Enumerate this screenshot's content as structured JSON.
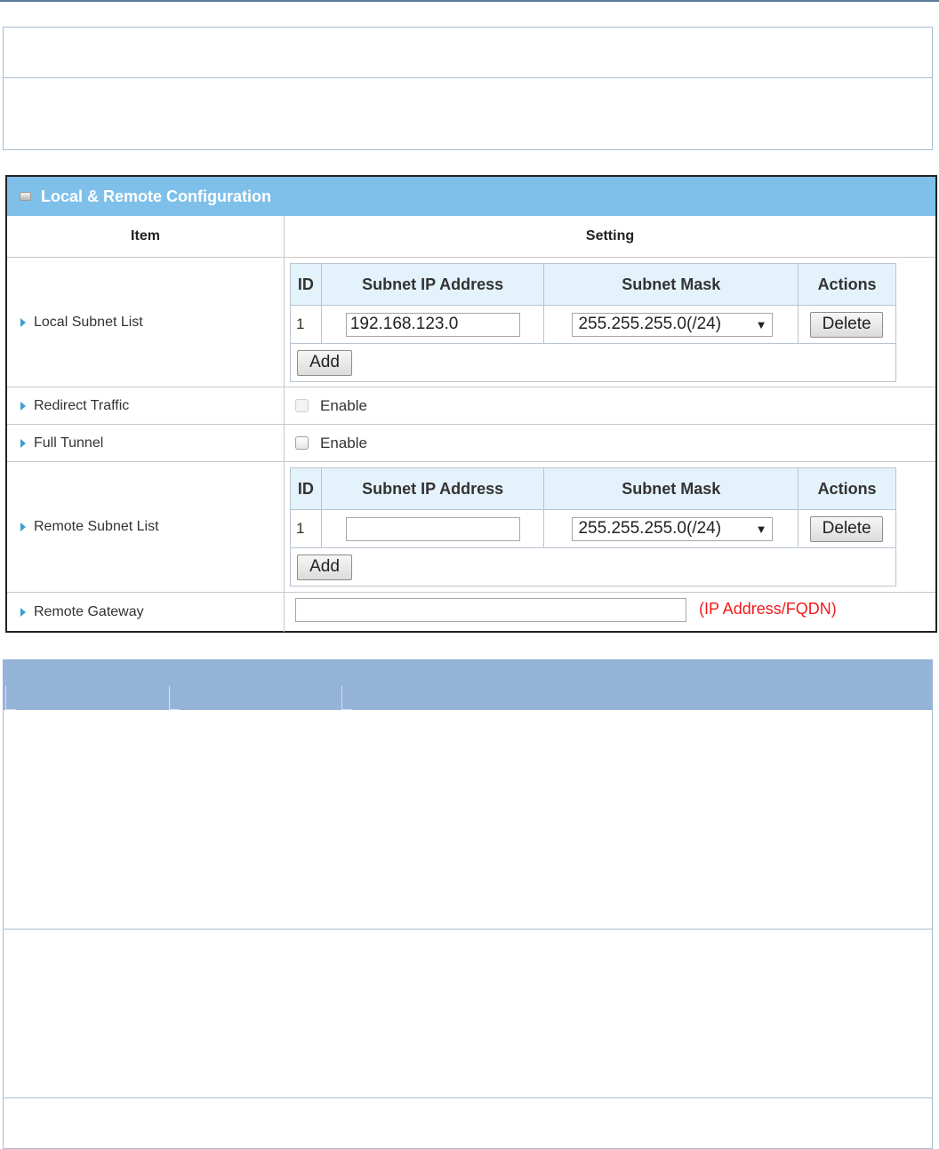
{
  "panel": {
    "title": "Local & Remote Configuration",
    "header_item": "Item",
    "header_setting": "Setting"
  },
  "subnet_table_headers": {
    "id": "ID",
    "ip": "Subnet IP Address",
    "mask": "Subnet Mask",
    "actions": "Actions"
  },
  "local_subnet": {
    "label": "Local Subnet List",
    "row": {
      "id": "1",
      "ip": "192.168.123.0",
      "mask": "255.255.255.0(/24)"
    },
    "delete_label": "Delete",
    "add_label": "Add"
  },
  "redirect_traffic": {
    "label": "Redirect Traffic",
    "checkbox_label": "Enable"
  },
  "full_tunnel": {
    "label": "Full Tunnel",
    "checkbox_label": "Enable"
  },
  "remote_subnet": {
    "label": "Remote Subnet List",
    "row": {
      "id": "1",
      "ip": "",
      "mask": "255.255.255.0(/24)"
    },
    "delete_label": "Delete",
    "add_label": "Add"
  },
  "remote_gateway": {
    "label": "Remote Gateway",
    "value": "",
    "hint": "(IP Address/FQDN)"
  },
  "colors": {
    "panel_header": "#7ec0ea",
    "table_header": "#e4f2fc",
    "hint_red": "#f21a1a",
    "doc_table_header": "#95b3d7"
  }
}
